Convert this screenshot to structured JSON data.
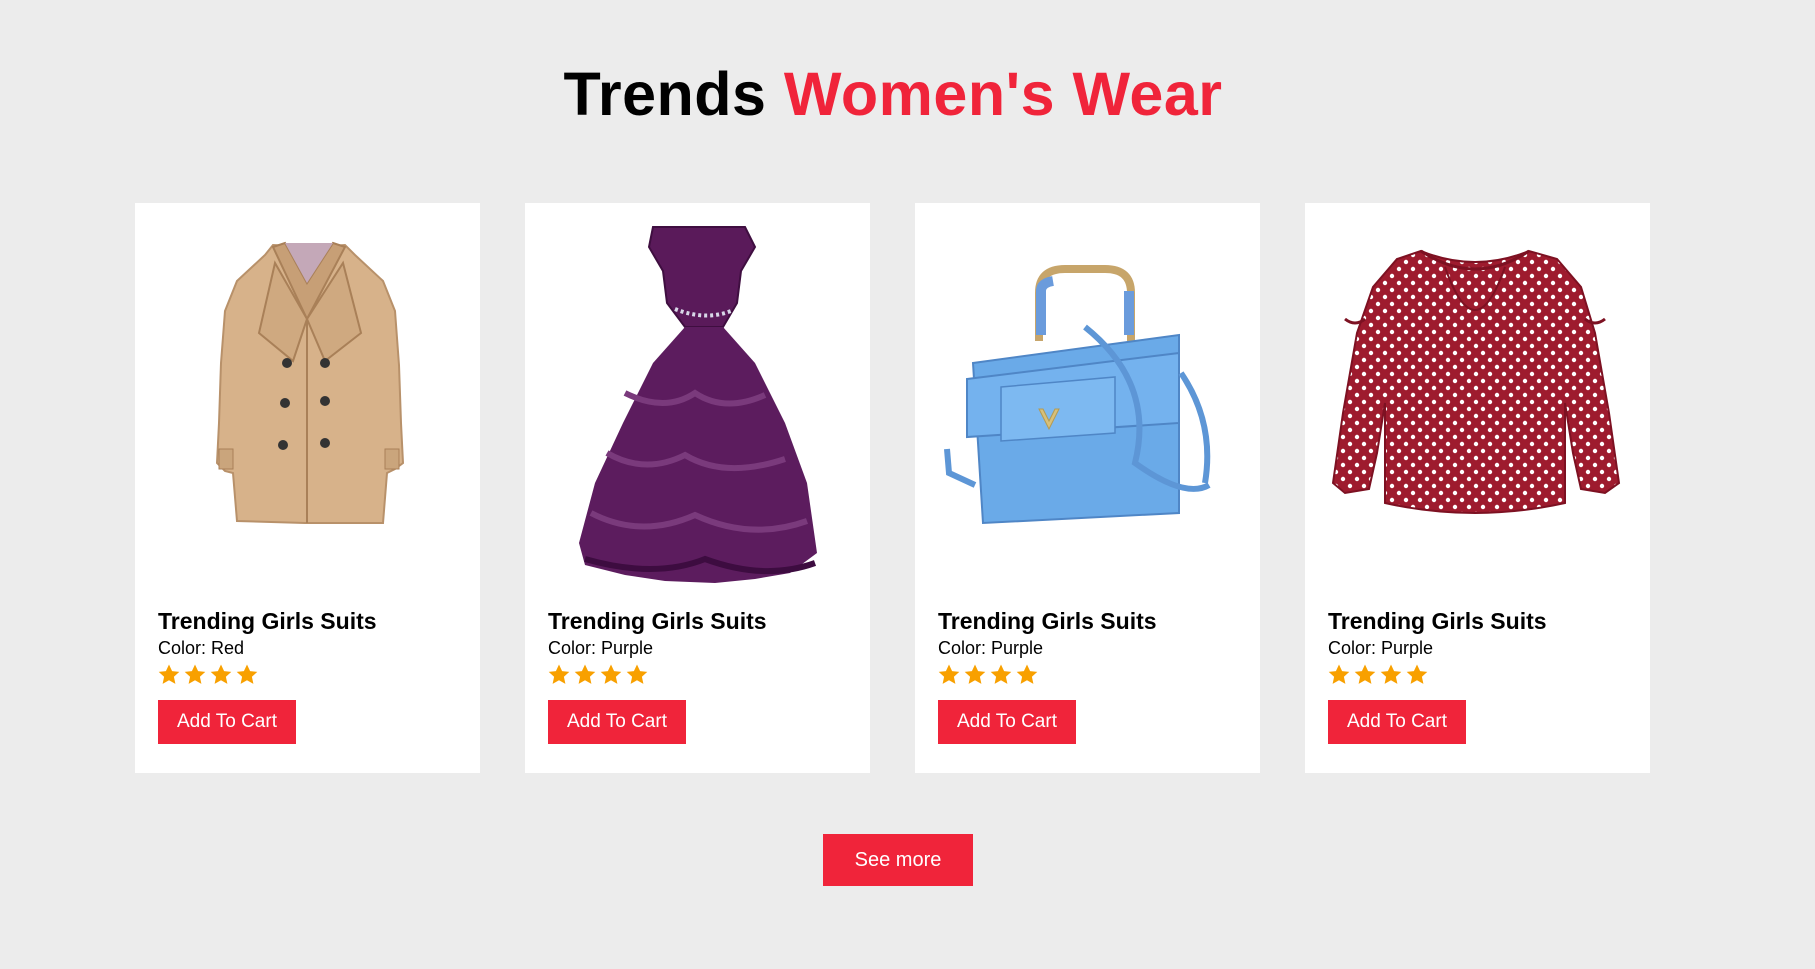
{
  "section": {
    "title_plain": "Trends",
    "title_accent": "Women's Wear"
  },
  "colors": {
    "background": "#ececec",
    "accent": "#f0243a",
    "card": "#ffffff",
    "star": "#f8a000"
  },
  "products": [
    {
      "image_icon": "beige-trench-coat",
      "name": "Trending Girls Suits",
      "color_label": "Color: Red",
      "rating": 4,
      "button_label": "Add To Cart"
    },
    {
      "image_icon": "purple-ruffle-gown",
      "name": "Trending Girls Suits",
      "color_label": "Color: Purple",
      "rating": 4,
      "button_label": "Add To Cart"
    },
    {
      "image_icon": "blue-handbag",
      "name": "Trending Girls Suits",
      "color_label": "Color: Purple",
      "rating": 4,
      "button_label": "Add To Cart"
    },
    {
      "image_icon": "red-polka-dot-blouse",
      "name": "Trending Girls Suits",
      "color_label": "Color: Purple",
      "rating": 4,
      "button_label": "Add To Cart"
    }
  ],
  "see_more_label": "See more"
}
